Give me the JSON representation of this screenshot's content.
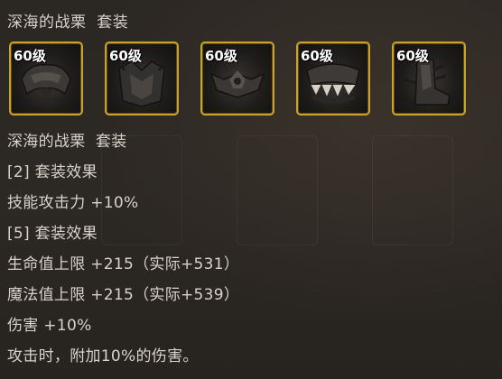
{
  "set_title": "深海的战栗  套装",
  "items": [
    {
      "level": "60级",
      "icon": "dark-shoulder-armor-icon"
    },
    {
      "level": "60级",
      "icon": "dark-chest-armor-icon"
    },
    {
      "level": "60级",
      "icon": "dark-bat-belt-icon"
    },
    {
      "level": "60级",
      "icon": "dark-fanged-leg-armor-icon"
    },
    {
      "level": "60级",
      "icon": "dark-spiked-boots-icon"
    }
  ],
  "details": {
    "name": "深海的战栗  套装",
    "set2_header": "[2] 套装效果",
    "set2_effect": "技能攻击力 +10%",
    "set5_header": "[5] 套装效果",
    "set5_hp": "生命值上限 +215（实际+531）",
    "set5_mp": "魔法值上限 +215（实际+539）",
    "set5_damage": "伤害 +10%",
    "set5_extra": "攻击时，附加10%的伤害。"
  },
  "colors": {
    "frame_gold": "#c8a22a",
    "text": "#d8d2c8",
    "background": "#2a2622"
  }
}
